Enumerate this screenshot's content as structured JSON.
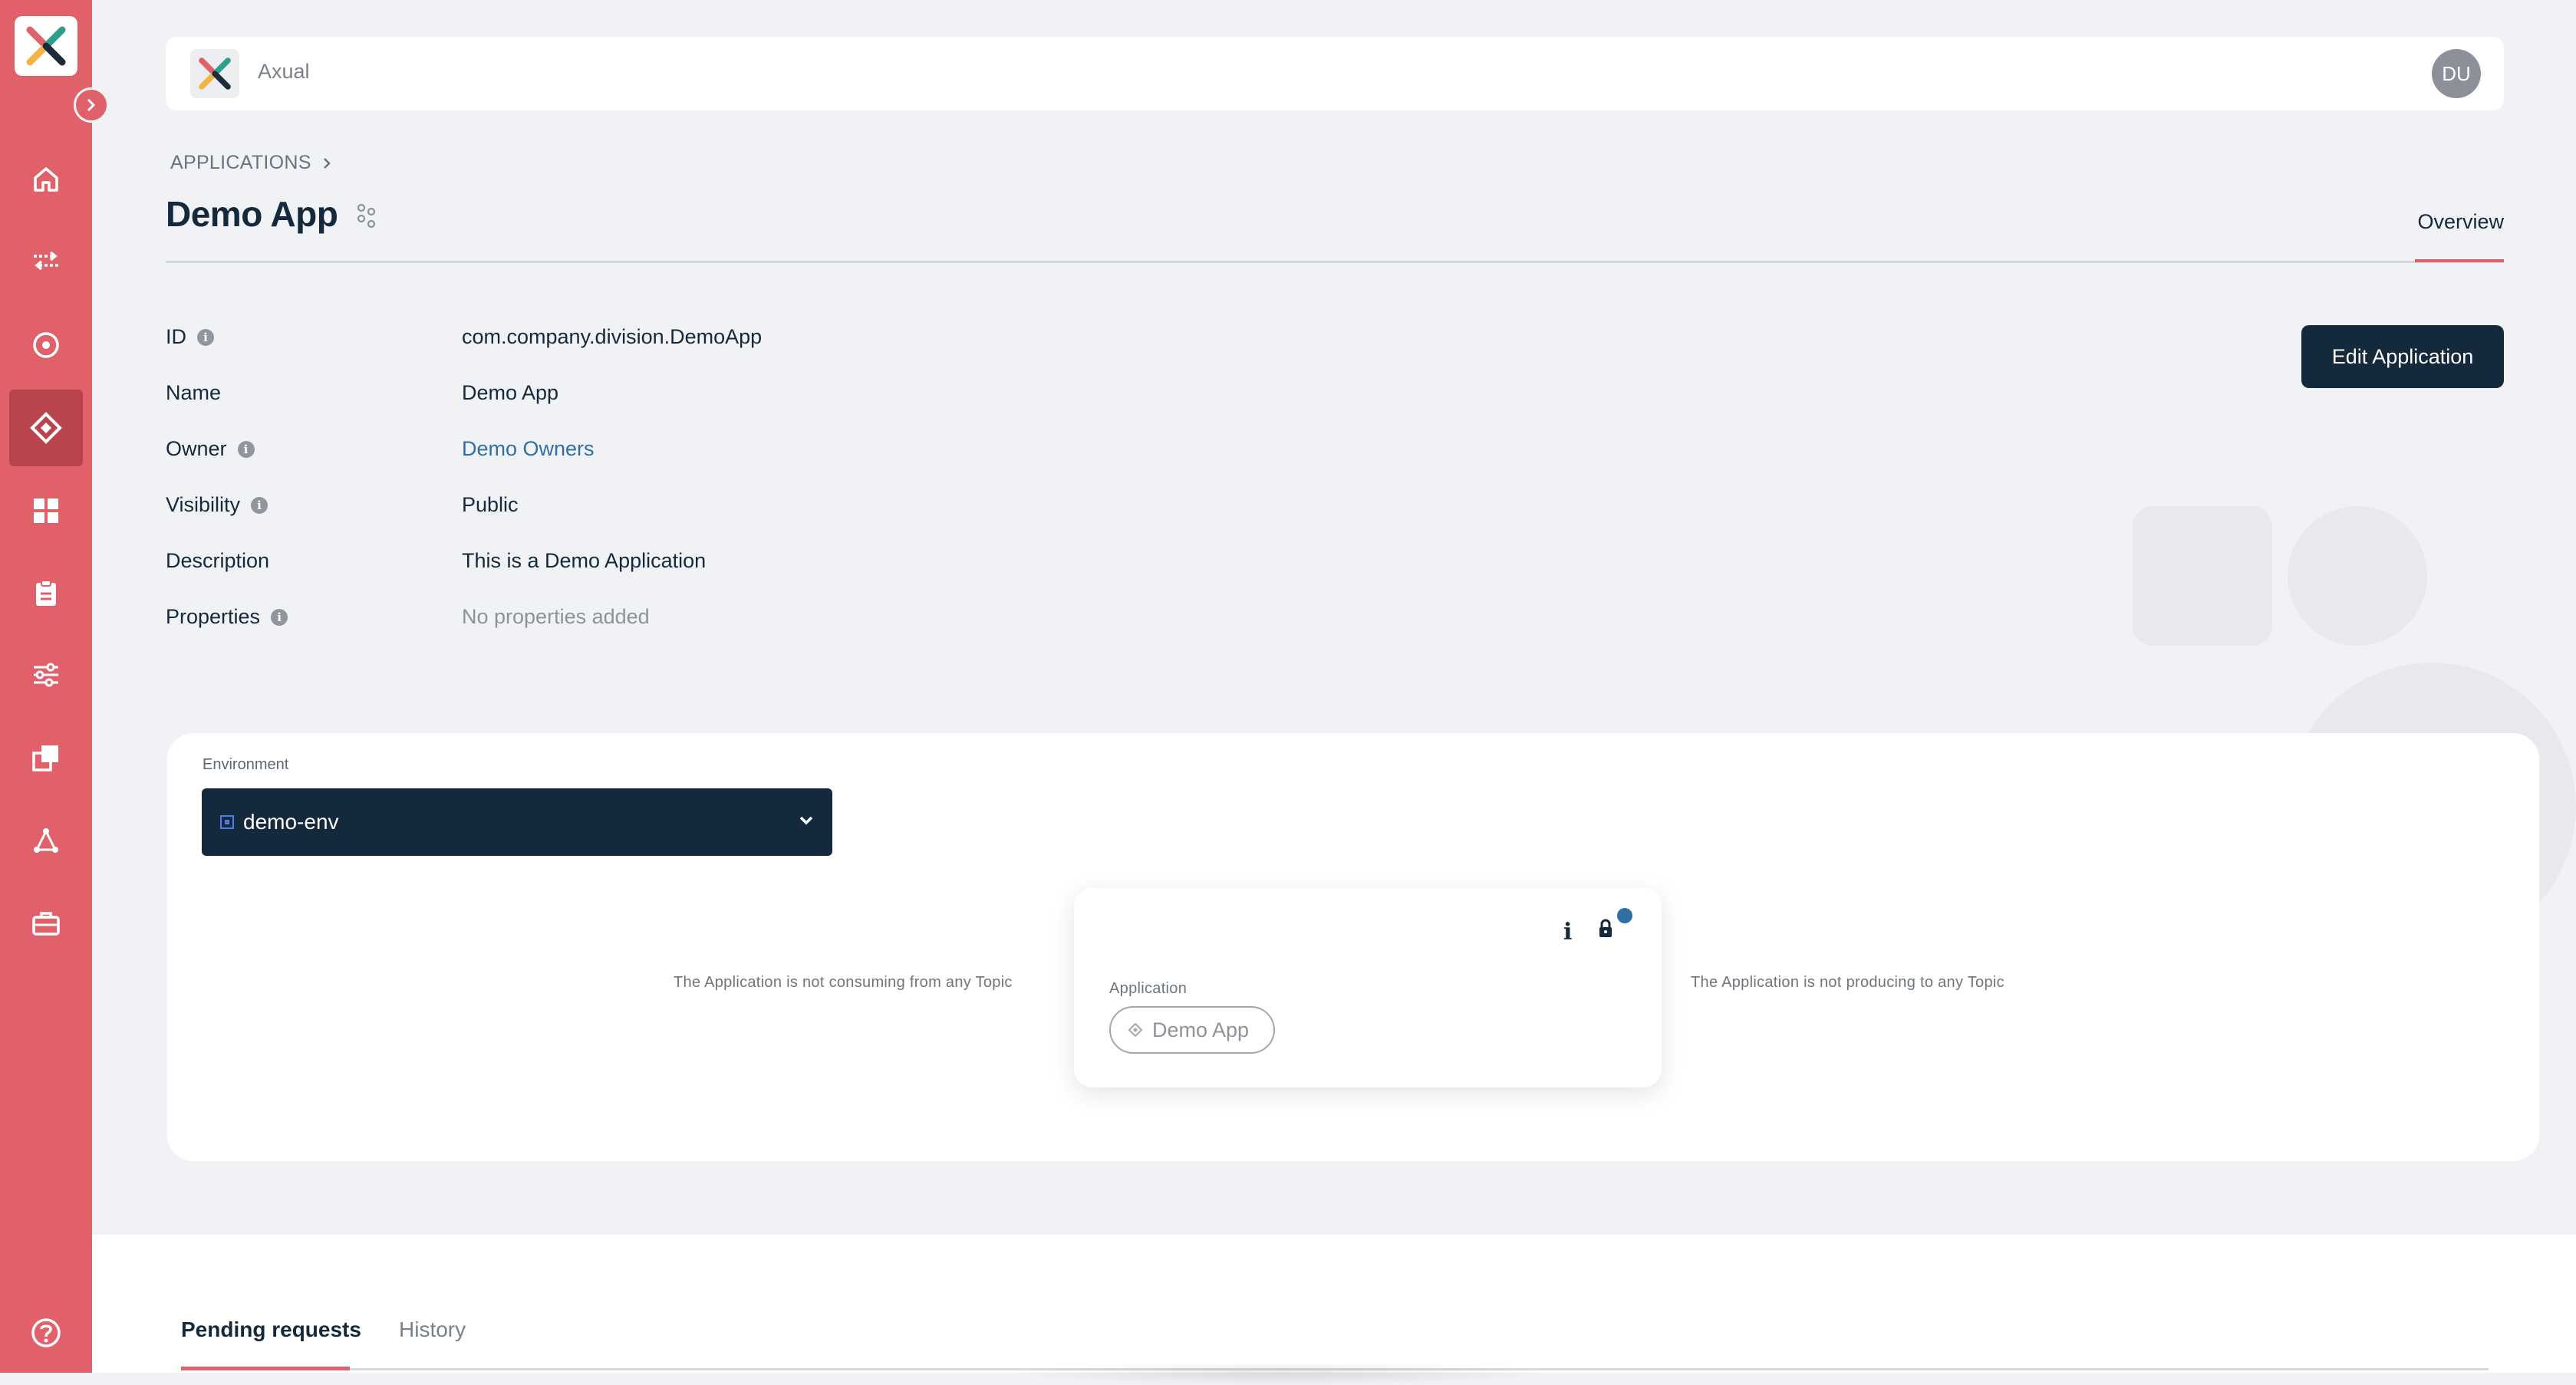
{
  "sidebar": {
    "accent": "#e0616a",
    "active_item": "applications",
    "items": [
      {
        "name": "home",
        "icon": "home-icon"
      },
      {
        "name": "streams",
        "icon": "arrows-exchange-icon"
      },
      {
        "name": "topics",
        "icon": "target-icon"
      },
      {
        "name": "applications",
        "icon": "diamond-icon"
      },
      {
        "name": "dashboard",
        "icon": "dashboard-icon"
      },
      {
        "name": "clipboard",
        "icon": "clipboard-icon"
      },
      {
        "name": "settings",
        "icon": "sliders-icon"
      },
      {
        "name": "copy",
        "icon": "copy-icon"
      },
      {
        "name": "network",
        "icon": "network-icon"
      },
      {
        "name": "tools",
        "icon": "toolbox-icon"
      }
    ],
    "help_icon": "help-circle-icon"
  },
  "topbar": {
    "org_name": "Axual",
    "avatar_initials": "DU"
  },
  "breadcrumb": {
    "root": "APPLICATIONS"
  },
  "page": {
    "title": "Demo App",
    "tab": "Overview"
  },
  "details": {
    "id_label": "ID",
    "id_value": "com.company.division.DemoApp",
    "name_label": "Name",
    "name_value": "Demo App",
    "owner_label": "Owner",
    "owner_value": "Demo Owners",
    "visibility_label": "Visibility",
    "visibility_value": "Public",
    "description_label": "Description",
    "description_value": "This is a Demo Application",
    "properties_label": "Properties",
    "properties_value": "No properties added"
  },
  "actions": {
    "edit_label": "Edit Application"
  },
  "environment": {
    "label": "Environment",
    "selected": "demo-env",
    "consuming_note": "The Application is not consuming from any Topic",
    "producing_note": "The Application is not producing to any Topic",
    "node": {
      "type_label": "Application",
      "chip_label": "Demo App",
      "info_glyph": "i"
    }
  },
  "bottom_tabs": {
    "pending": "Pending requests",
    "history": "History"
  }
}
